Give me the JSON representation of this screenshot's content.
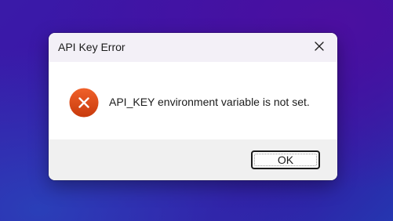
{
  "dialog": {
    "title": "API Key Error",
    "close_icon": "close-icon",
    "status_icon": "error-icon",
    "message": "API_KEY environment variable is not set.",
    "ok_label": "OK"
  },
  "colors": {
    "background": "#3b14a6",
    "error_icon": "#d83b01",
    "title_bar": "#f3f0f7",
    "footer": "#f0f0f0"
  }
}
